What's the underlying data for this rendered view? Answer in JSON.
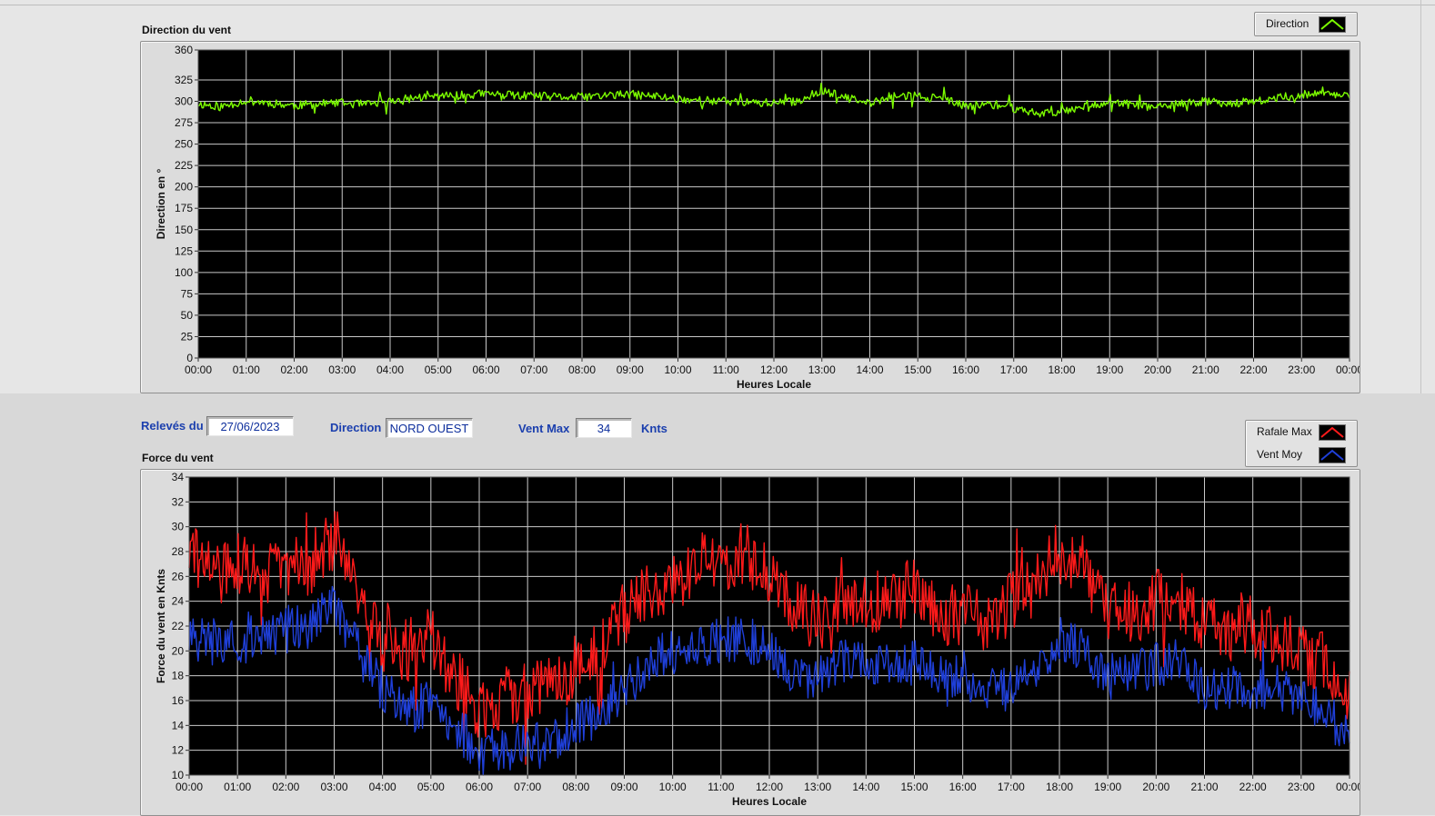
{
  "direction_graph": {
    "title": "Direction du vent",
    "legend": [
      {
        "label": "Direction",
        "color": "#7cfc00"
      }
    ]
  },
  "force_graph": {
    "title": "Force du vent",
    "legend": [
      {
        "label": "Rafale Max",
        "color": "#ff1a1a"
      },
      {
        "label": "Vent Moy",
        "color": "#1f3fd8"
      }
    ]
  },
  "info_bar": {
    "releves_label": "Relevés du",
    "releves_value": "27/06/2023",
    "direction_label": "Direction",
    "direction_value": "NORD OUEST",
    "ventmax_label": "Vent Max",
    "ventmax_value": "34",
    "ventmax_unit": "Knts"
  },
  "chart_data": [
    {
      "type": "line",
      "title": "Direction du vent",
      "xlabel": "Heures Locale",
      "ylabel": "Direction en °",
      "xticks": [
        "00:00",
        "01:00",
        "02:00",
        "03:00",
        "04:00",
        "05:00",
        "06:00",
        "07:00",
        "08:00",
        "09:00",
        "10:00",
        "11:00",
        "12:00",
        "13:00",
        "14:00",
        "15:00",
        "16:00",
        "17:00",
        "18:00",
        "19:00",
        "20:00",
        "21:00",
        "22:00",
        "23:00",
        "00:00"
      ],
      "yticks": [
        0,
        25,
        50,
        75,
        100,
        125,
        150,
        175,
        200,
        225,
        250,
        275,
        300,
        325,
        360
      ],
      "ylim": [
        0,
        360
      ],
      "xlim_hours": [
        0,
        24
      ],
      "grid": true,
      "legend_position": "top-right",
      "series": [
        {
          "name": "Direction",
          "color": "#7cfc00",
          "x_hours": [
            0,
            0.5,
            1,
            1.5,
            2,
            2.5,
            3,
            3.5,
            4,
            4.5,
            5,
            5.5,
            6,
            6.5,
            7,
            7.5,
            8,
            8.5,
            9,
            9.5,
            10,
            10.5,
            11,
            11.5,
            12,
            12.5,
            13,
            13.5,
            14,
            14.5,
            15,
            15.5,
            16,
            16.5,
            17,
            17.5,
            18,
            18.5,
            19,
            19.5,
            20,
            20.5,
            21,
            21.5,
            22,
            22.5,
            23,
            23.5,
            24
          ],
          "values": [
            297,
            294,
            301,
            298,
            295,
            297,
            298,
            296,
            300,
            304,
            306,
            307,
            309,
            307,
            306,
            305,
            305,
            307,
            308,
            306,
            303,
            301,
            300,
            299,
            298,
            300,
            313,
            304,
            297,
            307,
            306,
            303,
            294,
            297,
            292,
            286,
            288,
            296,
            298,
            296,
            293,
            297,
            300,
            298,
            299,
            304,
            308,
            309,
            307
          ]
        }
      ]
    },
    {
      "type": "line",
      "title": "Force du vent",
      "xlabel": "Heures Locale",
      "ylabel": "Force du vent en Knts",
      "xticks": [
        "00:00",
        "01:00",
        "02:00",
        "03:00",
        "04:00",
        "05:00",
        "06:00",
        "07:00",
        "08:00",
        "09:00",
        "10:00",
        "11:00",
        "12:00",
        "13:00",
        "14:00",
        "15:00",
        "16:00",
        "17:00",
        "18:00",
        "19:00",
        "20:00",
        "21:00",
        "22:00",
        "23:00",
        "00:00"
      ],
      "yticks": [
        10,
        12,
        14,
        16,
        18,
        20,
        22,
        24,
        26,
        28,
        30,
        32,
        34
      ],
      "ylim": [
        10,
        34
      ],
      "xlim_hours": [
        0,
        24
      ],
      "grid": true,
      "legend_position": "top-right",
      "series": [
        {
          "name": "Rafale Max",
          "color": "#ff1a1a",
          "x_hours": [
            0,
            0.5,
            1,
            1.5,
            2,
            2.5,
            3,
            3.5,
            4,
            4.5,
            5,
            5.5,
            6,
            6.5,
            7,
            7.5,
            8,
            8.5,
            9,
            9.5,
            10,
            10.5,
            11,
            11.5,
            12,
            12.5,
            13,
            13.5,
            14,
            14.5,
            15,
            15.5,
            16,
            16.5,
            17,
            17.5,
            18,
            18.5,
            19,
            19.5,
            20,
            20.5,
            21,
            21.5,
            22,
            22.5,
            23,
            23.5,
            24
          ],
          "values": [
            28,
            26,
            27,
            26,
            27,
            27,
            29,
            24,
            21,
            20,
            21,
            18,
            15,
            16,
            17,
            17,
            19,
            20,
            23,
            25,
            25,
            27,
            27,
            28,
            26,
            24,
            23,
            24,
            24,
            24,
            25,
            23,
            23,
            22,
            24,
            25,
            28,
            26,
            23,
            23,
            24,
            24,
            22,
            21,
            22,
            21,
            20,
            19,
            16
          ]
        },
        {
          "name": "Vent Moy",
          "color": "#1f3fd8",
          "x_hours": [
            0,
            0.5,
            1,
            1.5,
            2,
            2.5,
            3,
            3.5,
            4,
            4.5,
            5,
            5.5,
            6,
            6.5,
            7,
            7.5,
            8,
            8.5,
            9,
            9.5,
            10,
            10.5,
            11,
            11.5,
            12,
            12.5,
            13,
            13.5,
            14,
            14.5,
            15,
            15.5,
            16,
            16.5,
            17,
            17.5,
            18,
            18.5,
            19,
            19.5,
            20,
            20.5,
            21,
            21.5,
            22,
            22.5,
            23,
            23.5,
            24
          ],
          "values": [
            21,
            21,
            21,
            21,
            22,
            22,
            24,
            20,
            17,
            15,
            16,
            14,
            12,
            12,
            13,
            13,
            14,
            15,
            17,
            19,
            20,
            20,
            21,
            21,
            20,
            18,
            18,
            19,
            19,
            19,
            19,
            18,
            18,
            17,
            17,
            18,
            21,
            20,
            18,
            18,
            19,
            19,
            17,
            17,
            17,
            17,
            16,
            15,
            13
          ]
        }
      ]
    }
  ]
}
